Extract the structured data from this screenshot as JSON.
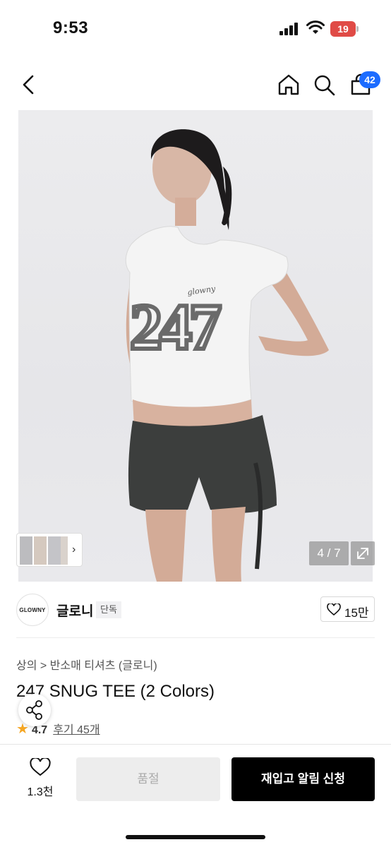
{
  "status_bar": {
    "time": "9:53",
    "battery": "19",
    "battery_color": "#e04b46",
    "icons": [
      "signal-icon",
      "wifi-icon",
      "battery-icon"
    ]
  },
  "nav": {
    "icons": [
      "back-icon",
      "home-icon",
      "search-icon",
      "cart-icon"
    ],
    "cart_count": "42",
    "badge_color": "#1c6cff"
  },
  "gallery": {
    "counter": "4 / 7",
    "icons": [
      "expand-icon",
      "chevron-right-icon"
    ]
  },
  "brand": {
    "logo_text": "GLOWNY",
    "name": "글로니",
    "tag": "단독",
    "likes": "15만"
  },
  "product": {
    "breadcrumb": "상의 > 반소매 티셔츠 (글로니)",
    "title": "247 SNUG TEE (2 Colors)",
    "rating": "4.7",
    "reviews": "후기 45개"
  },
  "bottom": {
    "wish_count": "1.3천",
    "soldout_label": "품절",
    "restock_label": "재입고 알림 신청"
  }
}
